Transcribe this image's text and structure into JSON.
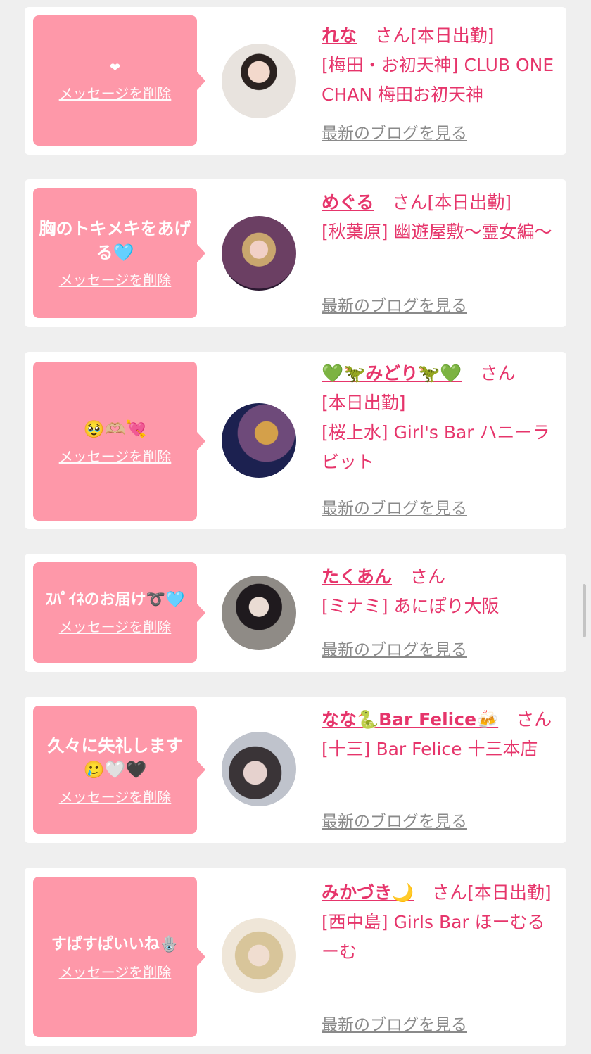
{
  "theme": {
    "accent": "#e6356b",
    "bubble": "#fe98a9",
    "background": "#efefef",
    "link_gray": "#8a8a8a"
  },
  "common": {
    "delete_label": "メッセージを削除",
    "blog_label": "最新のブログを見る"
  },
  "items": [
    {
      "message": "❤",
      "name": "れな",
      "suffix": "さん[本日出勤]",
      "shop": "[梅田・お初天神] CLUB ONE CHAN 梅田お初天神",
      "avatar_icon": "profile-photo"
    },
    {
      "message": "胸のトキメキをあげる🩵",
      "name": "めぐる",
      "suffix": "さん[本日出勤]",
      "shop": "[秋葉原] 幽遊屋敷〜霊女編〜",
      "avatar_icon": "profile-photo"
    },
    {
      "message": "🥹🫶🏼💘",
      "name": "💚🦖みどり🦖💚",
      "suffix": "さん",
      "status": "[本日出勤]",
      "shop": "[桜上水] Girl's Bar ハニーラビット",
      "avatar_icon": "profile-photo"
    },
    {
      "message": "ｽﾊﾟｲﾈのお届け➰🩵",
      "name": "たくあん",
      "suffix": "さん",
      "shop": "[ミナミ] あにぽり大阪",
      "avatar_icon": "profile-photo"
    },
    {
      "message": "久々に失礼します🥲🤍🖤",
      "name": "なな🐍Bar Felice🍻",
      "suffix": "さん",
      "shop": "[十三] Bar Felice 十三本店",
      "avatar_icon": "profile-photo"
    },
    {
      "message": "すぱすぱいいね🪬",
      "name": "みかづき🌙",
      "suffix": "さん[本日出勤]",
      "shop": "[西中島] Girls Bar ほーむるーむ",
      "avatar_icon": "profile-photo"
    }
  ]
}
